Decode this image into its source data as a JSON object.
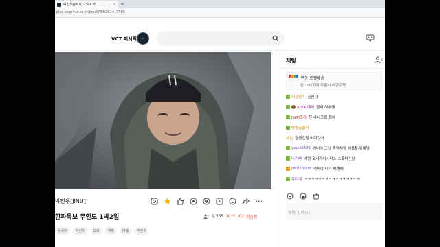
{
  "browser": {
    "tab_title": "박진우[JINU] - SOOP",
    "tab_close": "×",
    "new_tab": "+",
    "url": "play.sooplive.co.kr/jinu6734/281417565"
  },
  "header": {
    "channel_name": "VCT 퍼시픽",
    "logo_text": "VCT",
    "search_placeholder": ""
  },
  "stream": {
    "streamer": "박진우[JINU]",
    "title": "한파특보 무인도 1박2일",
    "viewers": "1,355",
    "elapsed": "10:31:02",
    "live_label": "방송중",
    "tags": [
      "한국어",
      "박진우",
      "보라",
      "먹방",
      "여행",
      "박진우"
    ]
  },
  "actions": [
    {
      "name": "bookmark-icon"
    },
    {
      "name": "star-icon"
    },
    {
      "name": "thumbs-up-icon"
    },
    {
      "name": "gift-icon"
    },
    {
      "name": "heart-icon"
    },
    {
      "name": "clip-icon"
    },
    {
      "name": "sticker-icon"
    },
    {
      "name": "share-icon"
    },
    {
      "name": "more-icon"
    }
  ],
  "chat": {
    "title": "채팅",
    "notice_title": "쿠팡 로켓배송",
    "notice_sub": "밤12시까지 주문시 내일도착",
    "messages": [
      {
        "nick": "세상삼기",
        "text": "곰인가",
        "nick_color": "#c98a1b",
        "badge_color": "#7cb342"
      },
      {
        "nick": "AJINU매라",
        "text": "빨리 해명해",
        "nick_color": "#a23a8e",
        "badge_color": "#7cb342",
        "badge2": "#8d5a2b"
      },
      {
        "nick": "[NS]조아",
        "text": "전 수니그룹 최애",
        "nick_color": "#b8342a",
        "badge_color": "#7cb342"
      },
      {
        "nick": "방송출발러",
        "text": "",
        "nick_color": "#c98a1b",
        "badge_color": "#7cb342"
      },
      {
        "nick": "유섭",
        "text": "잘생긴형 어디갔어",
        "nick_color": "#c98a1b",
        "badge_color": ""
      },
      {
        "nick": "youri3506",
        "text": "깨비야 그냥 죽댁처럼 어설플게 해명",
        "nick_color": "#7b3db5",
        "badge_color": "#7cb342"
      },
      {
        "nick": "나기빠",
        "text": "해명 오네가이시마스 스토퍼인님",
        "nick_color": "#7b3db5",
        "badge_color": "#7cb342"
      },
      {
        "nick": "JINU250jm",
        "text": "깨비야 니가 해명해",
        "nick_color": "#7b3db5",
        "badge_color": "#e3a11d"
      },
      {
        "nick": "우디게",
        "text": "ㅋㅋㅋㅋㅋㅋㅋㅋㅋㅋㅋㅋㅋㅋㅋㅋ",
        "nick_color": "#7b3db5",
        "badge_color": "#7cb342"
      }
    ],
    "input_placeholder": "채팅 입력(c)"
  },
  "colors": {
    "accent": "#e55a3c",
    "chat_border": "#e6e7ea"
  }
}
